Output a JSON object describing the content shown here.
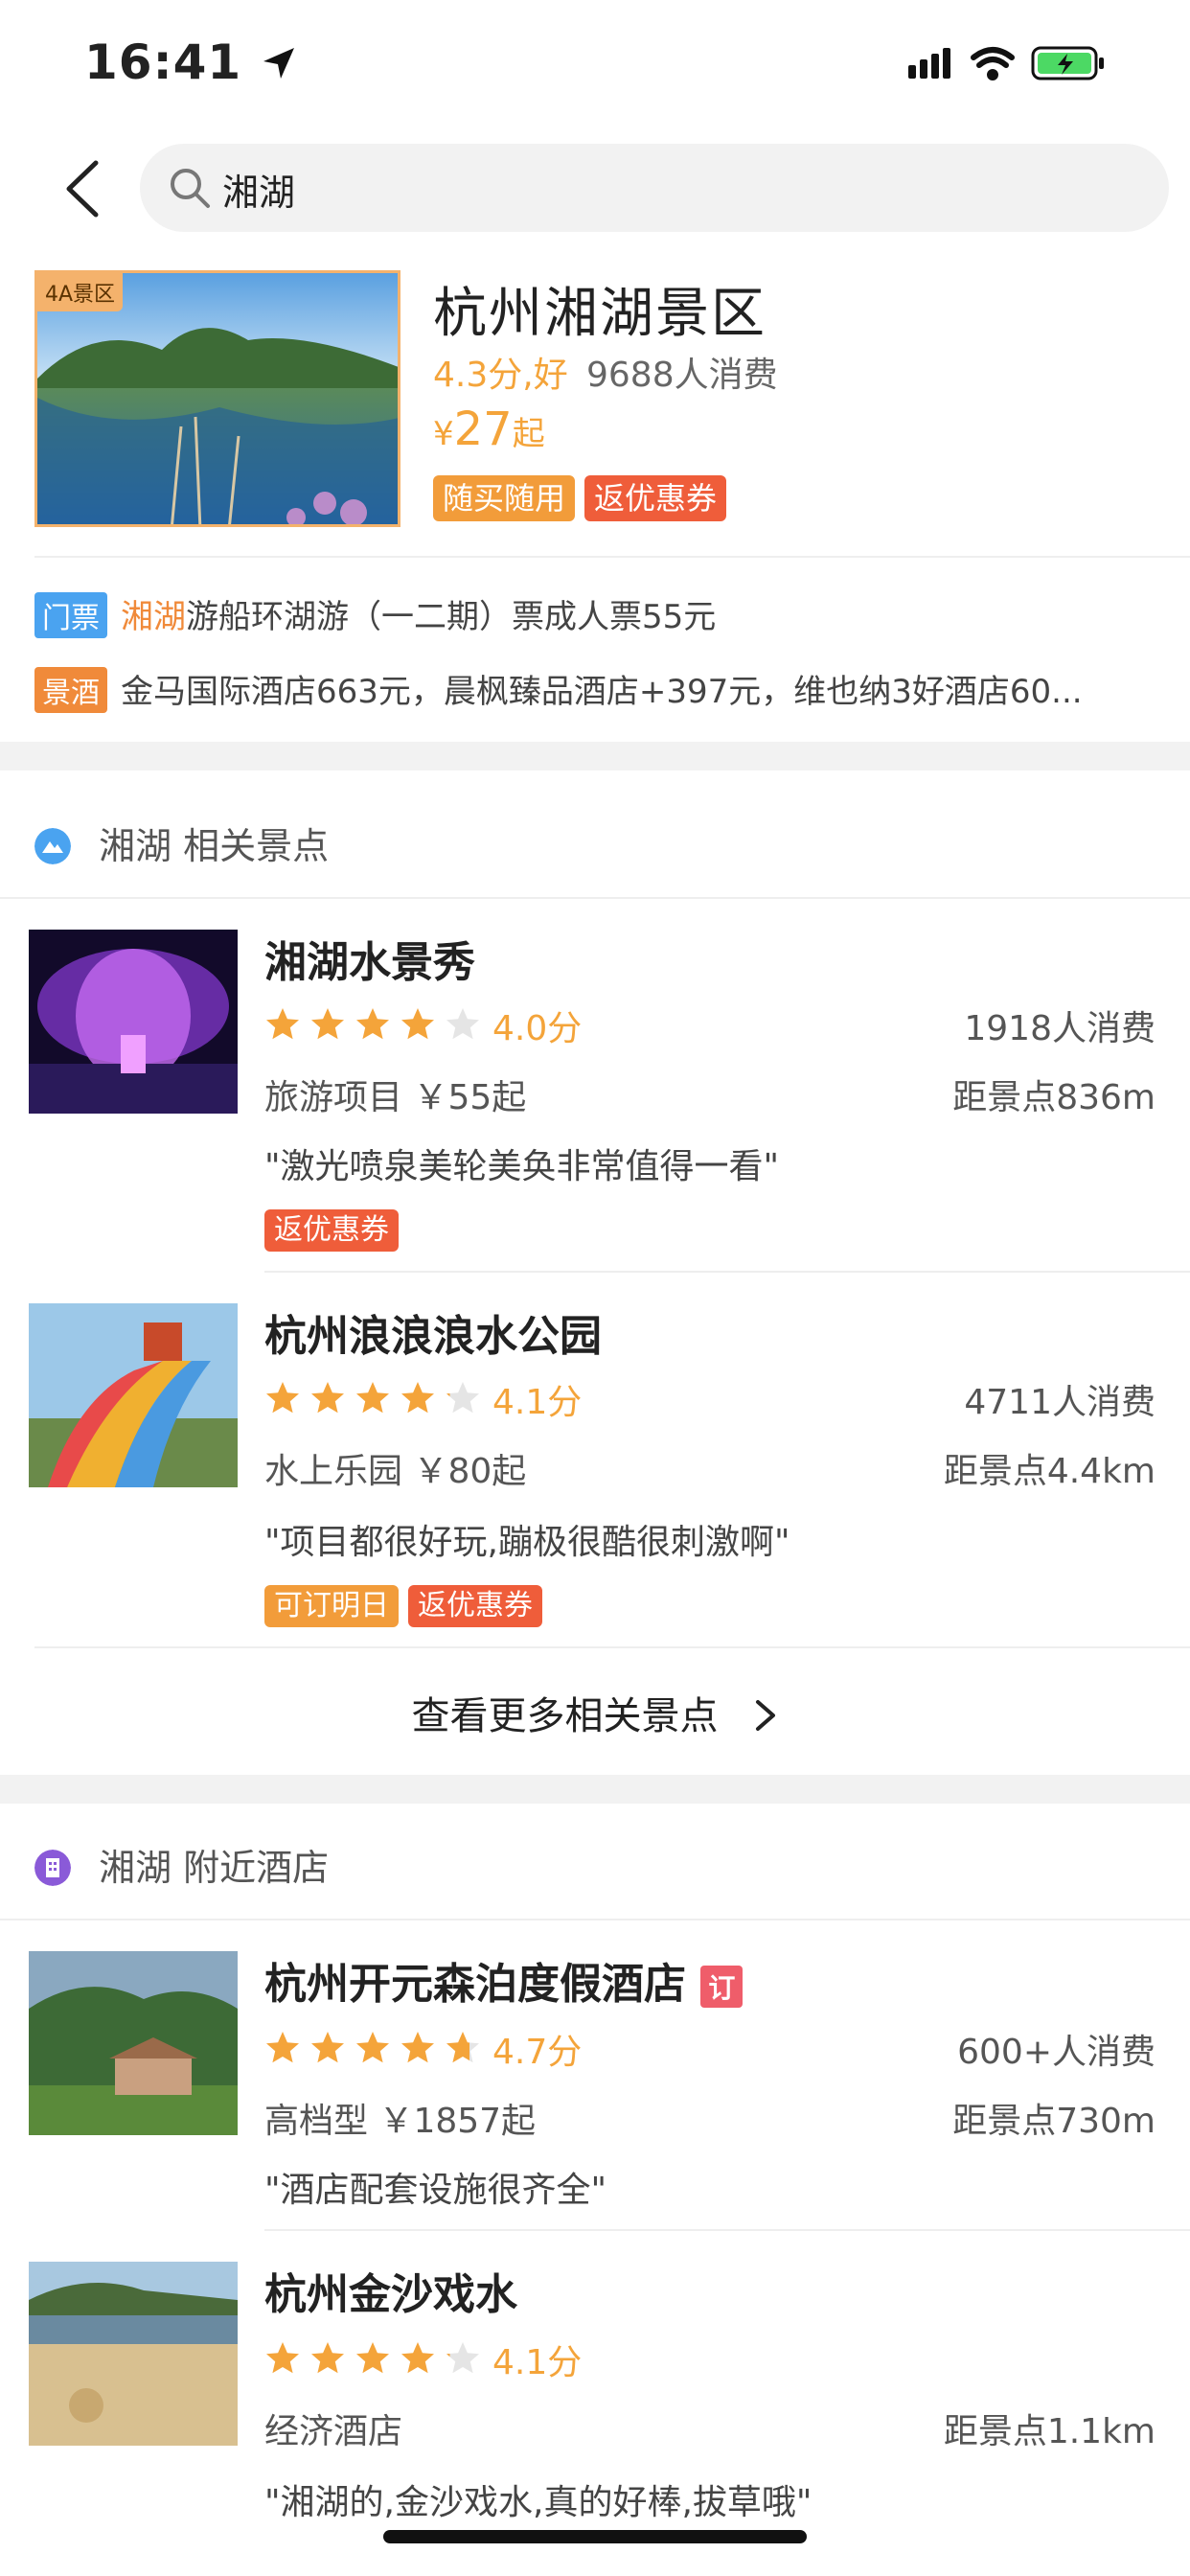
{
  "status": {
    "time": "16:41"
  },
  "search": {
    "query": "湘湖"
  },
  "hero": {
    "badge": "4A景区",
    "title": "杭州湘湖景区",
    "score": "4.3分,好",
    "sales": "9688人消费",
    "price_currency": "¥",
    "price_value": "27",
    "price_suffix": "起",
    "tags": [
      "随买随用",
      "返优惠券"
    ],
    "rows": [
      {
        "label": "门票",
        "highlight": "湘湖",
        "text": "游船环湖游（一二期）票成人票55元"
      },
      {
        "label": "景酒",
        "highlight": "",
        "text": "金马国际酒店663元，晨枫臻品酒店+397元，维也纳3好酒店60..."
      }
    ]
  },
  "spots_section": {
    "title": "湘湖 相关景点",
    "items": [
      {
        "title": "湘湖水景秀",
        "rating": 4.0,
        "score": "4.0分",
        "sales": "1918人消费",
        "meta": "旅游项目 ￥55起",
        "distance": "距景点836m",
        "quote": "\"激光喷泉美轮美奂非常值得一看\"",
        "tags": [
          {
            "text": "返优惠券",
            "color": "#ef5d3a"
          }
        ]
      },
      {
        "title": "杭州浪浪浪水公园",
        "rating": 4.1,
        "score": "4.1分",
        "sales": "4711人消费",
        "meta": "水上乐园 ￥80起",
        "distance": "距景点4.4km",
        "quote": "\"项目都很好玩,蹦极很酷很刺激啊\"",
        "tags": [
          {
            "text": "可订明日",
            "color": "#f29c3a"
          },
          {
            "text": "返优惠券",
            "color": "#ef5d3a"
          }
        ]
      }
    ],
    "more_label": "查看更多相关景点"
  },
  "hotels_section": {
    "title": "湘湖 附近酒店",
    "items": [
      {
        "title": "杭州开元森泊度假酒店",
        "badge": "订",
        "rating": 4.7,
        "score": "4.7分",
        "sales": "600+人消费",
        "meta": "高档型 ￥1857起",
        "distance": "距景点730m",
        "quote": "\"酒店配套设施很齐全\""
      },
      {
        "title": "杭州金沙戏水",
        "rating": 4.1,
        "score": "4.1分",
        "sales": "",
        "meta": "经济酒店",
        "distance": "距景点1.1km",
        "quote": "\"湘湖的,金沙戏水,真的好棒,拔草哦\""
      }
    ]
  },
  "colors": {
    "accent": "#f4a43a",
    "coupon": "#ef5d3a",
    "tag_orange": "#f29c3a",
    "star_empty": "#e5e5e5"
  }
}
